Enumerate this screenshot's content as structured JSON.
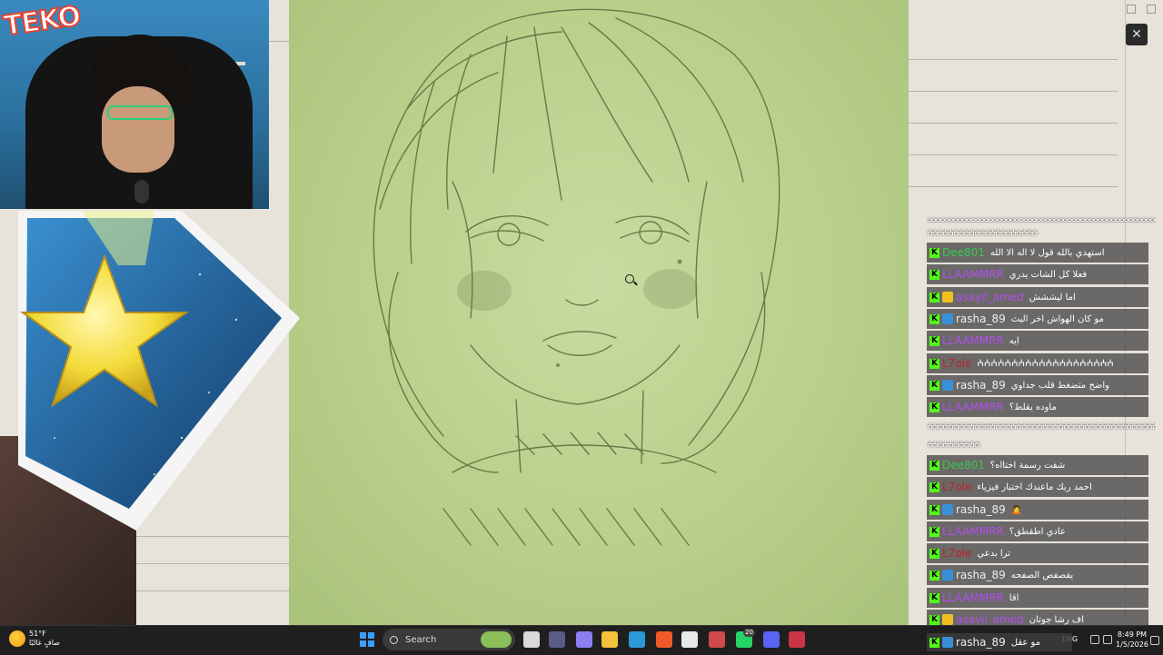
{
  "stream": {
    "logo_text": "TEKO"
  },
  "chat": {
    "separator_top": "ⴰⴰⴰⴰⴰⴰⴰⴰⴰⴰⴰⴰⴰⴰⴰⴰⴰⴰⴰⴰⴰⴰⴰⴰⴰⴰⴰⴰⴰⴰⴰⴰⴰⴰⴰⴰⴰⴰⴰⴰⴰⴰⴰⴰⴰⴰⴰⴰⴰⴰⴰⴰⴰⴰⴰ",
    "separator_hash1": "ⵄⵄⵄⵄⵄⵄⵄⵄⵄⵄⵄⵄⵄⵄⵄⵄⵄⵄⵄⵄⵄ",
    "separator_mid": "ⵄⵄⵄⵄⵄⵄⵄⵄⵄⵄⵄⵄⵄⵄⵄⵄⵄⵄⵄⵄⵄⵄⵄⵄⵄⵄⵄⵄⵄⵄⵄⵄⵄⵄⵄⵄⵄⵄⵄⵄⵄⵄⵄⵄⵄⵄⵄⵄⵄⵄⵄ",
    "separator_hash2": "ⵄⵄⵄⵄⵄⵄⵄⵄⵄⵄ",
    "messages": [
      {
        "user": "Dee801",
        "user_color": "#38c850",
        "text": "استهدي بالله قول لا اله الا الله",
        "second_badge": false
      },
      {
        "user": "LLAAMMRR",
        "user_color": "#b34df0",
        "text": "فعلا كل الشات يدري",
        "second_badge": false
      },
      {
        "user": "asayil_amed",
        "user_color": "#b34df0",
        "text": "امأ ليششش",
        "second_badge": true,
        "badge_color": "#f0c020"
      },
      {
        "user": "rasha_89",
        "user_color": "#eeeeee",
        "text": "مو كان الهواش اخر البث",
        "second_badge": true,
        "badge_color": "#3b8fd6"
      },
      {
        "user": "LLAAMMRR",
        "user_color": "#b34df0",
        "text": "ايه",
        "second_badge": false
      },
      {
        "user": "L7ole",
        "user_color": "#c0202a",
        "text": "ⵄⵄⵄⵄⵄⵄⵄⵄⵄⵄⵄⵄⵄⵄⵄⵄⵄⵄⵄⵄ",
        "second_badge": false
      },
      {
        "user": "rasha_89",
        "user_color": "#eeeeee",
        "text": "واضح متضغط قلب جداوي",
        "second_badge": true,
        "badge_color": "#3b8fd6"
      },
      {
        "user": "LLAAMMRR",
        "user_color": "#b34df0",
        "text": "ماوده يقلط؟",
        "second_badge": false
      },
      {
        "user": "Dee801",
        "user_color": "#38c850",
        "text": "شفت رسمة اختااه؟",
        "second_badge": false
      },
      {
        "user": "L7ole",
        "user_color": "#c0202a",
        "text": "احمد ربك ماعندك اختبار فيزياء",
        "second_badge": false
      },
      {
        "user": "rasha_89",
        "user_color": "#eeeeee",
        "text": "🙍",
        "second_badge": true,
        "badge_color": "#3b8fd6"
      },
      {
        "user": "LLAAMMRR",
        "user_color": "#b34df0",
        "text": "عادي اطقطق؟",
        "second_badge": false
      },
      {
        "user": "L7ole",
        "user_color": "#c0202a",
        "text": "ترا بدعي",
        "second_badge": false
      },
      {
        "user": "rasha_89",
        "user_color": "#eeeeee",
        "text": "يفصفص الصفحه",
        "second_badge": true,
        "badge_color": "#3b8fd6"
      },
      {
        "user": "LLAAMMRR",
        "user_color": "#b34df0",
        "text": "اقا",
        "second_badge": false
      },
      {
        "user": "asayil_amed",
        "user_color": "#b34df0",
        "text": "اف رشا جوتان",
        "second_badge": true,
        "badge_color": "#f0c020"
      },
      {
        "user": "rasha_89",
        "user_color": "#eeeeee",
        "text": "مو عقل",
        "second_badge": true,
        "badge_color": "#3b8fd6"
      }
    ]
  },
  "taskbar": {
    "weather_temp": "51°F",
    "weather_desc": "صافٍ غالبًا",
    "search_placeholder": "Search",
    "lang": "ENG",
    "time": "8:49 PM",
    "date": "1/5/2026",
    "badge_count": "20",
    "icons": [
      {
        "name": "task-view-icon",
        "color": "#d9d9d9"
      },
      {
        "name": "media-icon",
        "color": "#5b5b8a"
      },
      {
        "name": "copilot-icon",
        "color": "#8a7ef0"
      },
      {
        "name": "file-explorer-icon",
        "color": "#f2c23a"
      },
      {
        "name": "edge-icon",
        "color": "#2a9ad6"
      },
      {
        "name": "brave-icon",
        "color": "#f05a28"
      },
      {
        "name": "store-icon",
        "color": "#e8e8e8"
      },
      {
        "name": "app-icon",
        "color": "#d04a4a"
      },
      {
        "name": "whatsapp-icon",
        "color": "#25d366"
      },
      {
        "name": "discord-icon",
        "color": "#5865f2"
      },
      {
        "name": "obs-icon",
        "color": "#cc3344"
      }
    ]
  }
}
